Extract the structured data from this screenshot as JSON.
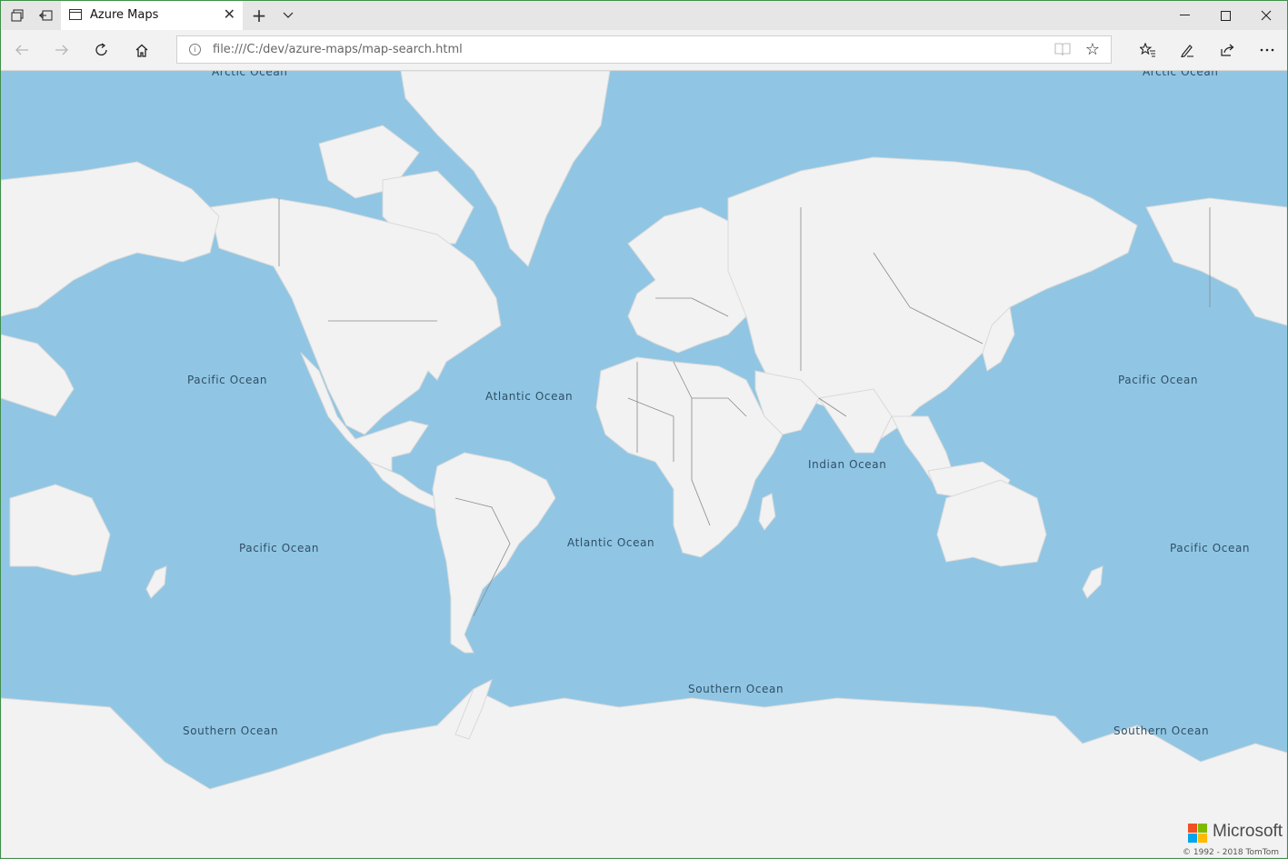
{
  "tab": {
    "title": "Azure Maps"
  },
  "address": {
    "url": "file:///C:/dev/azure-maps/map-search.html"
  },
  "map": {
    "ocean_labels": [
      "Arctic Ocean",
      "Arctic Ocean",
      "Pacific Ocean",
      "Pacific Ocean",
      "Atlantic Ocean",
      "Indian Ocean",
      "Pacific Ocean",
      "Atlantic Ocean",
      "Pacific Ocean",
      "Southern Ocean",
      "Southern Ocean",
      "Southern Ocean"
    ],
    "brand": "Microsoft",
    "copyright": "© 1992 - 2018 TomTom",
    "colors": {
      "water": "#90c6e4",
      "land": "#f2f2f2",
      "border": "#6e6e6e"
    }
  }
}
